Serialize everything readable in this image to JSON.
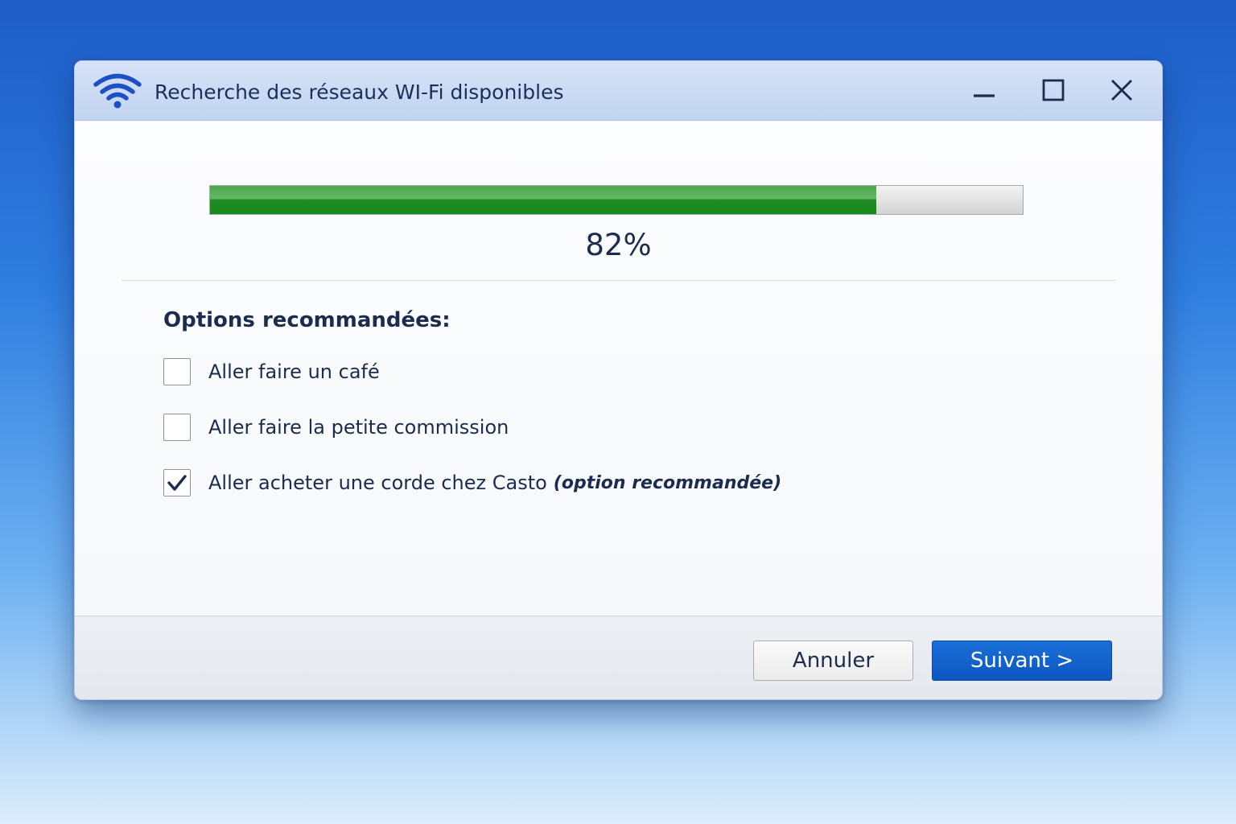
{
  "window": {
    "title": "Recherche des réseaux WI-Fi disponibles",
    "icon": "wifi-icon",
    "controls": {
      "minimize_icon": "minimize-icon",
      "maximize_icon": "maximize-icon",
      "close_icon": "close-icon"
    }
  },
  "progress": {
    "value": 0.82,
    "label": "82%",
    "fill_color": "#1f8b24"
  },
  "options": {
    "heading": "Options recommandées:",
    "items": [
      {
        "label": "Aller faire un café",
        "checked": false,
        "note": ""
      },
      {
        "label": "Aller faire la petite commission",
        "checked": false,
        "note": ""
      },
      {
        "label": "Aller acheter une corde chez Casto",
        "checked": true,
        "note": "(option recommandée)"
      }
    ]
  },
  "footer": {
    "cancel_label": "Annuler",
    "next_label": "Suivant  >"
  },
  "colors": {
    "accent": "#0d56c0",
    "titlebar": "#c9d9f3",
    "text": "#1c2c4f"
  }
}
